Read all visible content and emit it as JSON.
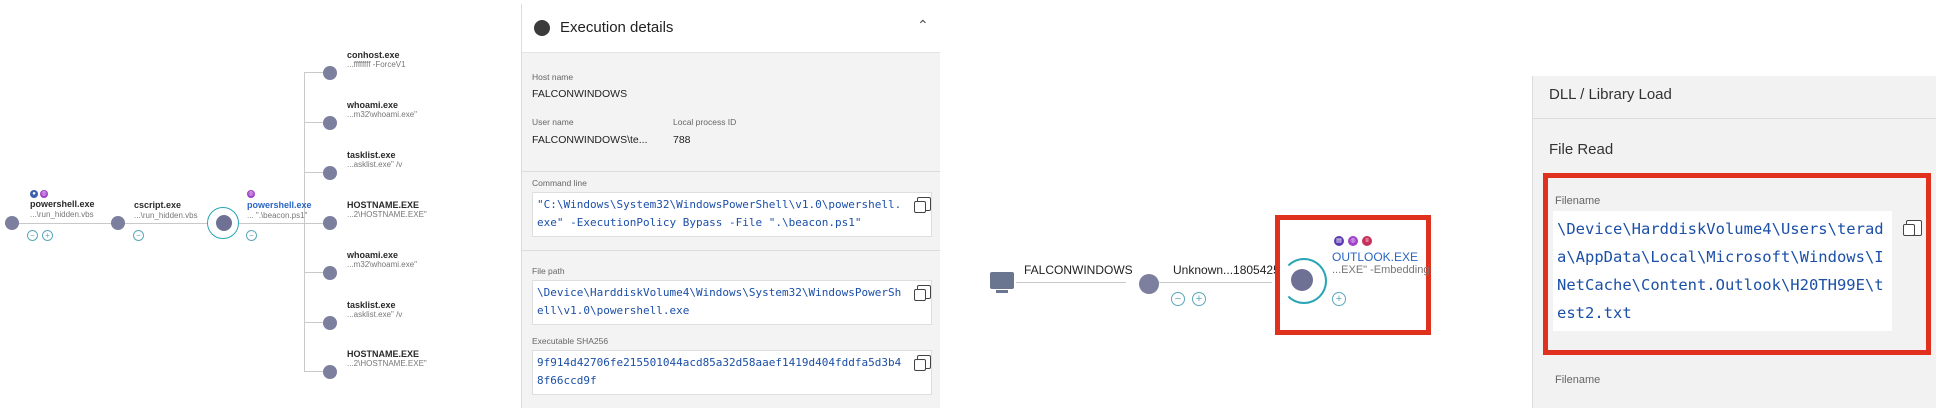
{
  "tree": {
    "nodes": [
      {
        "title": "powershell.exe",
        "sub": "...\\run_hidden.vbs"
      },
      {
        "title": "cscript.exe",
        "sub": "...\\run_hidden.vbs"
      },
      {
        "title": "powershell.exe",
        "sub": "... \".\\beacon.ps1\""
      },
      {
        "title": "conhost.exe",
        "sub": "...ffffffff -ForceV1"
      },
      {
        "title": "whoami.exe",
        "sub": "...m32\\whoami.exe\""
      },
      {
        "title": "tasklist.exe",
        "sub": "...asklist.exe\" /v"
      },
      {
        "title": "HOSTNAME.EXE",
        "sub": "...2\\HOSTNAME.EXE\""
      },
      {
        "title": "whoami.exe",
        "sub": "...m32\\whoami.exe\""
      },
      {
        "title": "tasklist.exe",
        "sub": "...asklist.exe\" /v"
      },
      {
        "title": "HOSTNAME.EXE",
        "sub": "...2\\HOSTNAME.EXE\""
      }
    ],
    "colors": {
      "node": "#7c7f9e",
      "ring": "#2aa5b5",
      "selected_title": "#2a64c4"
    }
  },
  "exec": {
    "title": "Execution details",
    "host_label": "Host name",
    "host_value": "FALCONWINDOWS",
    "user_label": "User name",
    "user_value": "FALCONWINDOWS\\te...",
    "pid_label": "Local process ID",
    "pid_value": "788",
    "cmd_label": "Command line",
    "cmd_value": "\"C:\\Windows\\System32\\WindowsPowerShell\\v1.0\\powershell.exe\" -ExecutionPolicy Bypass -File \".\\beacon.ps1\"",
    "path_label": "File path",
    "path_value": "\\Device\\HarddiskVolume4\\Windows\\System32\\WindowsPowerShell\\v1.0\\powershell.exe",
    "sha_label": "Executable SHA256",
    "sha_value": "9f914d42706fe215501044acd85a32d58aaef1419d404fddfa5d3b48f66ccd9f"
  },
  "outlook": {
    "host": "FALCONWINDOWS",
    "unknown": "Unknown...1805425",
    "process_title": "OUTLOOK.EXE",
    "process_sub": "...EXE\" -Embedding",
    "highlight_color": "#e0301e"
  },
  "file": {
    "section1": "DLL / Library Load",
    "section2": "File Read",
    "filename_label": "Filename",
    "filename_value": "\\Device\\HarddiskVolume4\\Users\\terada\\AppData\\Local\\Microsoft\\Windows\\INetCache\\Content.Outlook\\H20TH99E\\test2.txt",
    "filename_label2": "Filename"
  }
}
